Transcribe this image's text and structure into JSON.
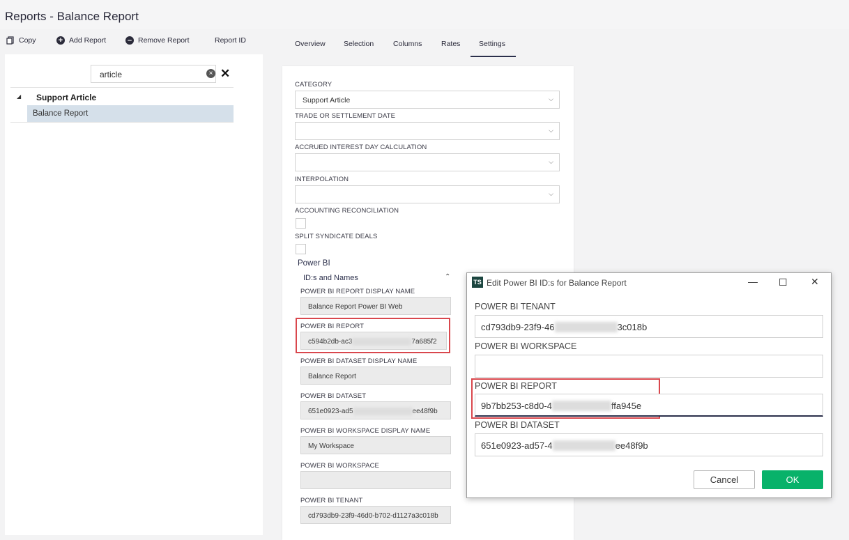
{
  "page": {
    "title": "Reports - Balance Report"
  },
  "toolbar": {
    "copy": "Copy",
    "add_report": "Add Report",
    "remove_report": "Remove Report",
    "report_id": "Report ID"
  },
  "search": {
    "value": "article"
  },
  "tree": {
    "group": "Support Article",
    "selected": "Balance Report"
  },
  "tabs": [
    "Overview",
    "Selection",
    "Columns",
    "Rates",
    "Settings"
  ],
  "settings": {
    "category_label": "CATEGORY",
    "category_value": "Support Article",
    "trade_label": "TRADE OR SETTLEMENT DATE",
    "accrued_label": "ACCRUED INTEREST DAY CALCULATION",
    "interpolation_label": "INTERPOLATION",
    "accounting_label": "ACCOUNTING RECONCILIATION",
    "split_label": "SPLIT SYNDICATE DEALS",
    "powerbi_header": "Power BI",
    "ids_header": "ID:s and Names",
    "report_display_name_label": "POWER BI REPORT DISPLAY NAME",
    "report_display_name_value": "Balance Report Power BI Web",
    "report_label": "POWER BI REPORT",
    "report_value_start": "c594b2db-ac3",
    "report_value_end": "7a685f2",
    "dataset_display_name_label": "POWER BI DATASET DISPLAY NAME",
    "dataset_display_name_value": "Balance Report",
    "dataset_label": "POWER BI DATASET",
    "dataset_value_start": "651e0923-ad5",
    "dataset_value_end": "ee48f9b",
    "workspace_display_name_label": "POWER BI WORKSPACE DISPLAY NAME",
    "workspace_display_name_value": "My Workspace",
    "workspace_label": "POWER BI WORKSPACE",
    "tenant_label": "POWER BI TENANT",
    "tenant_value": "cd793db9-23f9-46d0-b702-d1127a3c018b"
  },
  "dialog": {
    "logo": "TS",
    "title": "Edit Power BI ID:s for Balance Report",
    "tenant_label": "POWER BI TENANT",
    "tenant_start": "cd793db9-23f9-46",
    "tenant_end": "3c018b",
    "workspace_label": "POWER BI WORKSPACE",
    "report_label": "POWER BI REPORT",
    "report_start": "9b7bb253-c8d0-4",
    "report_end": "ffa945e",
    "dataset_label": "POWER BI DATASET",
    "dataset_start": "651e0923-ad57-4",
    "dataset_end": "ee48f9b",
    "cancel": "Cancel",
    "ok": "OK"
  }
}
